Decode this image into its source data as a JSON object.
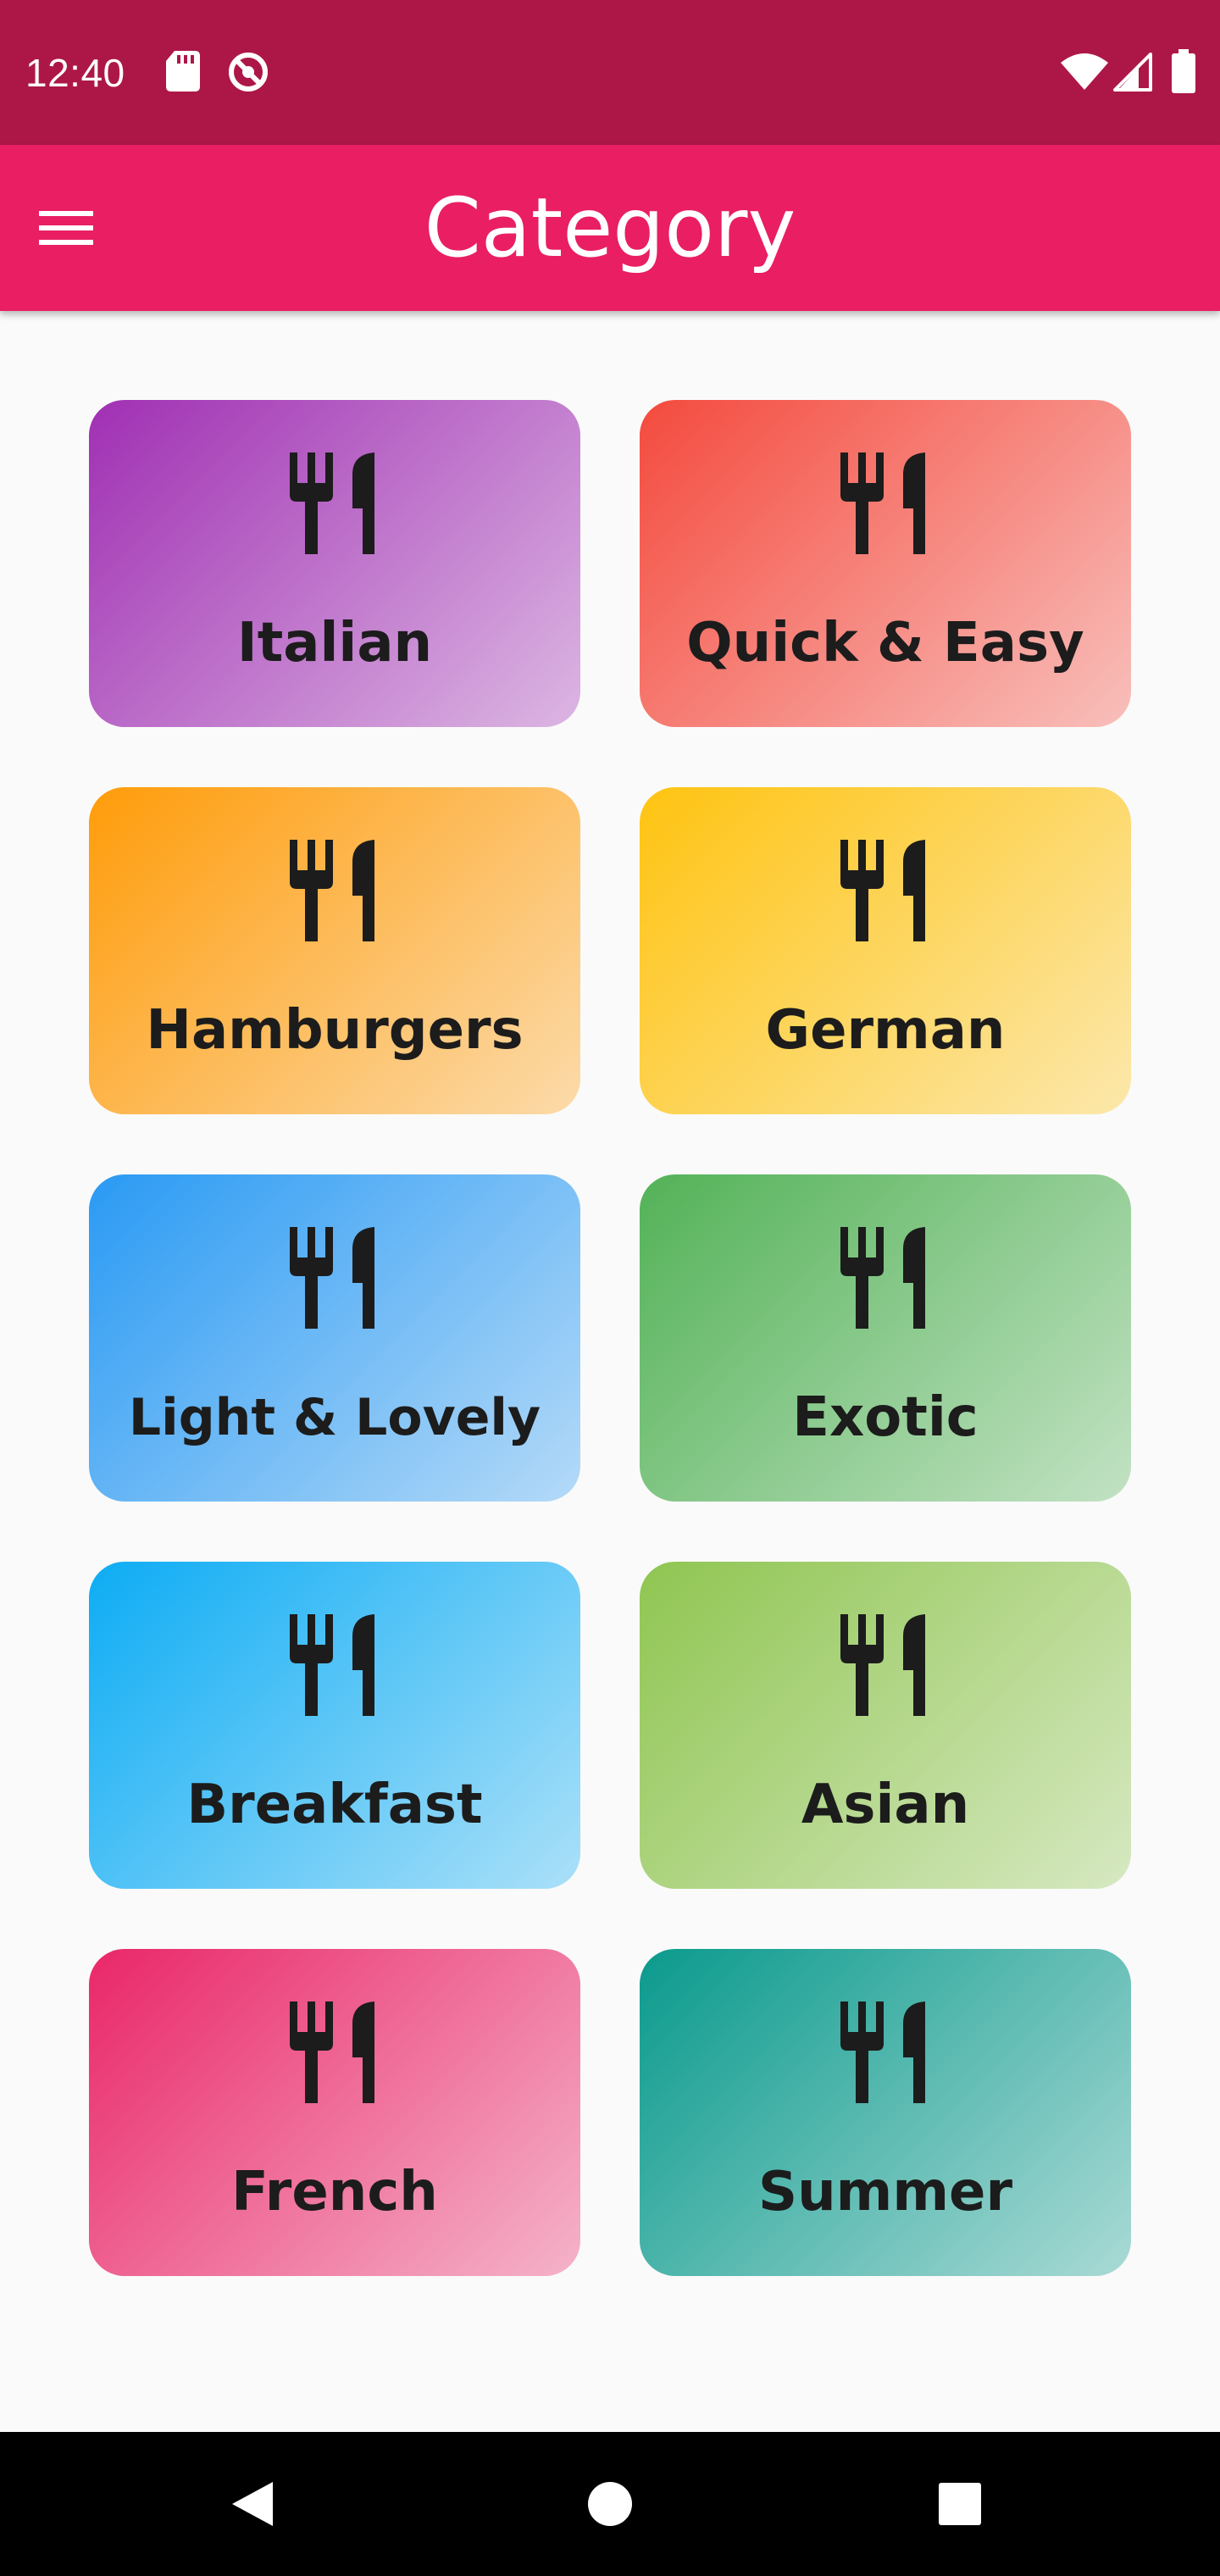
{
  "status_bar": {
    "time": "12:40",
    "left_icons": [
      "sd-card-icon",
      "do-not-disturb-icon"
    ],
    "right_icons": [
      "wifi-icon",
      "cell-signal-icon",
      "battery-icon"
    ]
  },
  "app_bar": {
    "title": "Category",
    "menu_icon": "hamburger-menu-icon"
  },
  "categories": [
    {
      "label": "Italian",
      "color": "#9c27b0",
      "icon": "restaurant-icon"
    },
    {
      "label": "Quick & Easy",
      "color": "#f44336",
      "icon": "restaurant-icon"
    },
    {
      "label": "Hamburgers",
      "color": "#ff9800",
      "icon": "restaurant-icon"
    },
    {
      "label": "German",
      "color": "#ffc107",
      "icon": "restaurant-icon"
    },
    {
      "label": "Light & Lovely",
      "color": "#2196f3",
      "icon": "restaurant-icon"
    },
    {
      "label": "Exotic",
      "color": "#4caf50",
      "icon": "restaurant-icon"
    },
    {
      "label": "Breakfast",
      "color": "#03a9f4",
      "icon": "restaurant-icon"
    },
    {
      "label": "Asian",
      "color": "#8bc34a",
      "icon": "restaurant-icon"
    },
    {
      "label": "French",
      "color": "#e91e63",
      "icon": "restaurant-icon"
    },
    {
      "label": "Summer",
      "color": "#009688",
      "icon": "restaurant-icon"
    }
  ],
  "nav_bar": {
    "buttons": [
      "back-triangle-icon",
      "home-circle-icon",
      "recents-square-icon"
    ]
  },
  "colors": {
    "status_bar": "#ad1748",
    "app_bar": "#e91e63",
    "background": "#fafafa",
    "text_on_primary": "#ffffff",
    "card_text": "#1c1c1c",
    "nav_bar": "#000000"
  }
}
